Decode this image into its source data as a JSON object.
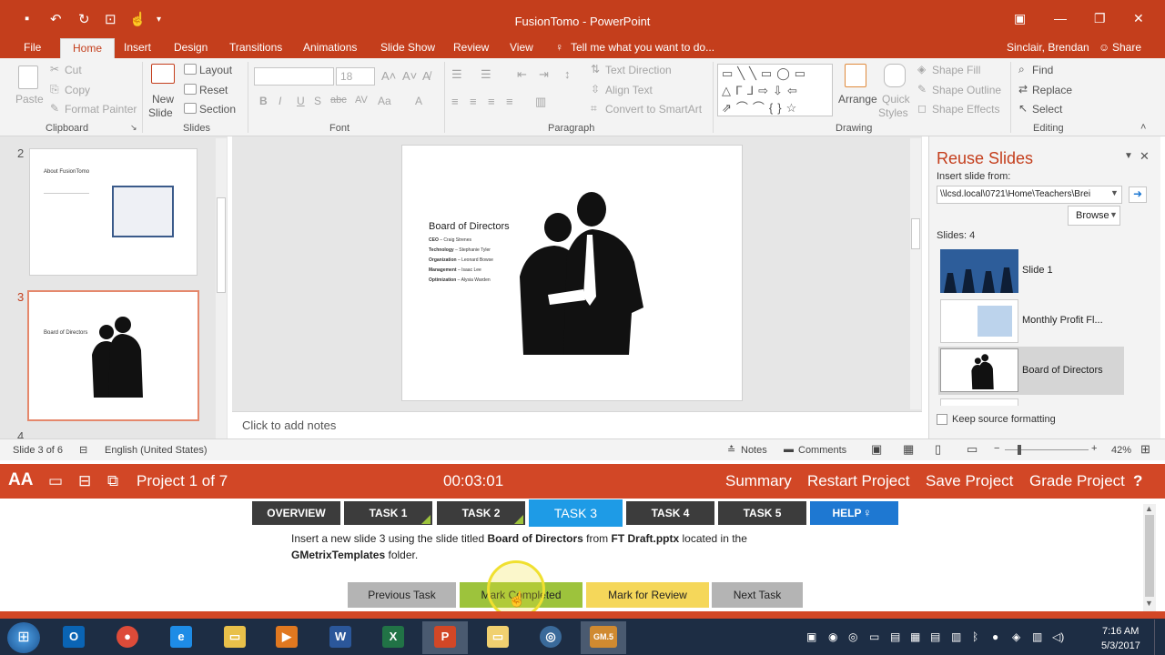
{
  "window": {
    "title": "FusionTomo - PowerPoint"
  },
  "tabs": [
    "File",
    "Home",
    "Insert",
    "Design",
    "Transitions",
    "Animations",
    "Slide Show",
    "Review",
    "View"
  ],
  "tell_me": "Tell me what you want to do...",
  "user": "Sinclair, Brendan",
  "share": "Share",
  "ribbon": {
    "clipboard": {
      "paste": "Paste",
      "cut": "Cut",
      "copy": "Copy",
      "format_painter": "Format Painter",
      "label": "Clipboard"
    },
    "slides": {
      "new_slide": "New",
      "new_slide2": "Slide",
      "layout": "Layout",
      "reset": "Reset",
      "section": "Section",
      "label": "Slides"
    },
    "font": {
      "size": "18",
      "label": "Font"
    },
    "paragraph": {
      "text_direction": "Text Direction",
      "align_text": "Align Text",
      "convert": "Convert to SmartArt",
      "label": "Paragraph"
    },
    "drawing": {
      "arrange": "Arrange",
      "quick": "Quick",
      "styles": "Styles",
      "shape_fill": "Shape Fill",
      "shape_outline": "Shape Outline",
      "shape_effects": "Shape Effects",
      "label": "Drawing"
    },
    "editing": {
      "find": "Find",
      "replace": "Replace",
      "select": "Select",
      "label": "Editing"
    }
  },
  "thumbnails": {
    "numbers": [
      "2",
      "3",
      "4"
    ],
    "slide2_title": "About FusionTomo",
    "slide3_title": "Board of Directors"
  },
  "slide": {
    "title": "Board of Directors",
    "items": [
      {
        "role": "CEO",
        "name": "Craig Strenes"
      },
      {
        "role": "Technology",
        "name": "Stephanie Tyler"
      },
      {
        "role": "Organization",
        "name": "Leonard Bowse"
      },
      {
        "role": "Management",
        "name": "Isaac Lee"
      },
      {
        "role": "Optimization",
        "name": "Alysia Warden"
      }
    ]
  },
  "notes_placeholder": "Click to add notes",
  "reuse": {
    "title": "Reuse Slides",
    "insert_from": "Insert slide from:",
    "path": "\\\\lcsd.local\\0721\\Home\\Teachers\\Brei",
    "browse": "Browse",
    "count": "Slides: 4",
    "slides": [
      "Slide 1",
      "Monthly Profit Fl...",
      "Board of Directors"
    ],
    "keep_formatting": "Keep source formatting"
  },
  "status": {
    "slide": "Slide 3 of 6",
    "language": "English (United States)",
    "notes": "Notes",
    "comments": "Comments",
    "zoom": "42%"
  },
  "gmetrix": {
    "project": "Project 1 of 7",
    "timer": "00:03:01",
    "summary": "Summary",
    "restart": "Restart Project",
    "save": "Save Project",
    "grade": "Grade Project",
    "help_icon": "?"
  },
  "tasks": [
    "OVERVIEW",
    "TASK 1",
    "TASK 2",
    "TASK 3",
    "TASK 4",
    "TASK 5",
    "HELP"
  ],
  "instruction": {
    "p1": "Insert a new slide 3 using the slide titled ",
    "b1": "Board of Directors",
    "p2": " from ",
    "b2": "FT Draft.pptx",
    "p3": " located in the",
    "b3": "GMetrixTemplates",
    "p4": " folder."
  },
  "actions": {
    "prev": "Previous Task",
    "complete": "Mark Completed",
    "review": "Mark for Review",
    "next": "Next Task"
  },
  "taskbar": {
    "time": "7:16 AM",
    "date": "5/3/2017",
    "gm_label": "GM.5"
  },
  "colors": {
    "accent": "#c43e1c",
    "gmetrix_bar": "#d24726",
    "task_dark": "#3c3c3c",
    "task_active": "#1e9be6",
    "help": "#1e78d2",
    "complete": "#9dc33c",
    "review": "#f5d75a",
    "neutral_btn": "#b4b4b4"
  }
}
